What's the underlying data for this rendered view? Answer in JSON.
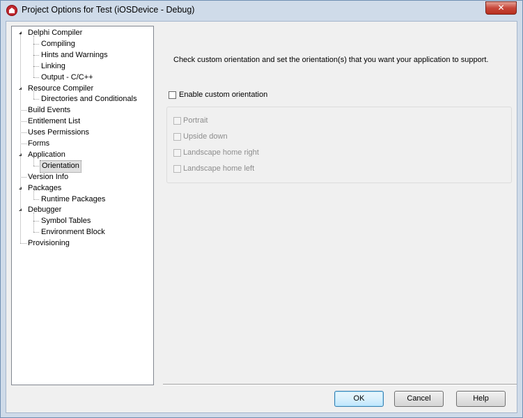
{
  "window": {
    "title": "Project Options for Test  (iOSDevice - Debug)",
    "close_label": "✕"
  },
  "tree": {
    "items": [
      {
        "label": "Delphi Compiler",
        "level": 0,
        "expanded": true
      },
      {
        "label": "Compiling",
        "level": 1
      },
      {
        "label": "Hints and Warnings",
        "level": 1
      },
      {
        "label": "Linking",
        "level": 1
      },
      {
        "label": "Output - C/C++",
        "level": 1
      },
      {
        "label": "Resource Compiler",
        "level": 0,
        "expanded": true
      },
      {
        "label": "Directories and Conditionals",
        "level": 1
      },
      {
        "label": "Build Events",
        "level": 0
      },
      {
        "label": "Entitlement List",
        "level": 0
      },
      {
        "label": "Uses Permissions",
        "level": 0
      },
      {
        "label": "Forms",
        "level": 0
      },
      {
        "label": "Application",
        "level": 0,
        "expanded": true
      },
      {
        "label": "Orientation",
        "level": 1,
        "selected": true
      },
      {
        "label": "Version Info",
        "level": 0
      },
      {
        "label": "Packages",
        "level": 0,
        "expanded": true
      },
      {
        "label": "Runtime Packages",
        "level": 1
      },
      {
        "label": "Debugger",
        "level": 0,
        "expanded": true
      },
      {
        "label": "Symbol Tables",
        "level": 1
      },
      {
        "label": "Environment Block",
        "level": 1
      },
      {
        "label": "Provisioning",
        "level": 0
      }
    ]
  },
  "orientation": {
    "description": "Check custom orientation and set the orientation(s) that you want your application to support.",
    "enable_label": "Enable custom orientation",
    "options": [
      {
        "label": "Portrait"
      },
      {
        "label": "Upside down"
      },
      {
        "label": "Landscape home right"
      },
      {
        "label": "Landscape home left"
      }
    ]
  },
  "buttons": {
    "ok": "OK",
    "cancel": "Cancel",
    "help": "Help"
  }
}
